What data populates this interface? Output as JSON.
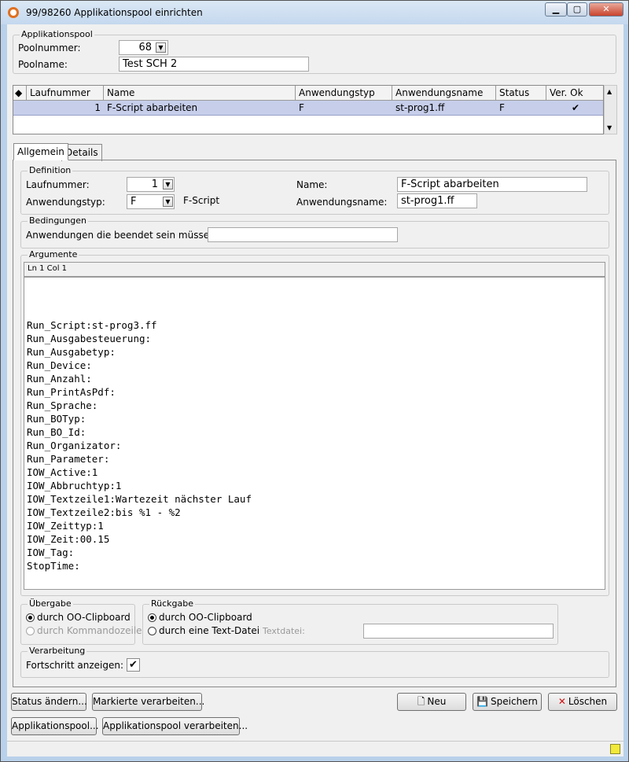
{
  "window": {
    "title": "99/98260 Applikationspool einrichten",
    "min": "▁",
    "max": "▢",
    "close": "✕"
  },
  "pool": {
    "group_label": "Applikationspool",
    "nummer_label": "Poolnummer:",
    "nummer_value": "68",
    "name_label": "Poolname:",
    "name_value": "Test SCH 2"
  },
  "grid": {
    "headers": [
      "Laufnummer",
      "Name",
      "Anwendungstyp",
      "Anwendungsname",
      "Status",
      "Ver. Ok"
    ],
    "rows": [
      {
        "laufnummer": "1",
        "name": "F-Script abarbeiten",
        "typ": "F",
        "anwendungsname": "st-prog1.ff",
        "status": "F",
        "ver_ok": "✔"
      }
    ]
  },
  "tabs": [
    "Allgemein",
    "Details"
  ],
  "definition": {
    "group_label": "Definition",
    "laufnummer_label": "Laufnummer:",
    "laufnummer_value": "1",
    "typ_label": "Anwendungstyp:",
    "typ_value": "F",
    "typ_text": "F-Script",
    "name_label": "Name:",
    "name_value": "F-Script abarbeiten",
    "anwname_label": "Anwendungsname:",
    "anwname_value": "st-prog1.ff"
  },
  "bedingungen": {
    "group_label": "Bedingungen",
    "label": "Anwendungen die beendet sein müssen:",
    "value": ""
  },
  "argumente": {
    "group_label": "Argumente",
    "status": "Ln 1  Col 1",
    "lines": [
      "Run_Script:st-prog3.ff",
      "Run_Ausgabesteuerung:",
      "Run_Ausgabetyp:",
      "Run_Device:",
      "Run_Anzahl:",
      "Run_PrintAsPdf:",
      "Run_Sprache:",
      "Run_BOTyp:",
      "Run_BO_Id:",
      "Run_Organizator:",
      "Run_Parameter:",
      "IOW_Active:1",
      "IOW_Abbruchtyp:1",
      "IOW_Textzeile1:Wartezeit nächster Lauf",
      "IOW_Textzeile2:bis %1 - %2",
      "IOW_Zeittyp:1",
      "IOW_Zeit:00.15",
      "IOW_Tag:",
      "StopTime:"
    ]
  },
  "uebergabe": {
    "group_label": "Übergabe",
    "opt1": "durch OO-Clipboard",
    "opt2": "durch Kommandozeile"
  },
  "rueckgabe": {
    "group_label": "Rückgabe",
    "opt1": "durch OO-Clipboard",
    "opt2": "durch eine Text-Datei",
    "textdatei_label": "Textdatei:",
    "textdatei_value": ""
  },
  "verarbeitung": {
    "group_label": "Verarbeitung",
    "label": "Fortschritt anzeigen:",
    "check": "✔"
  },
  "buttons": {
    "status_aendern": "Status ändern...",
    "markierte": "Markierte verarbeiten...",
    "neu": "Neu",
    "speichern": "Speichern",
    "loeschen": "Löschen",
    "applikationspool": "Applikationspool...",
    "applikationspool_verarbeiten": "Applikationspool verarbeiten..."
  },
  "colors": {
    "titlebar": "#c4d8ee",
    "selected_row": "#c6ceea",
    "client": "#f0f0f0"
  }
}
